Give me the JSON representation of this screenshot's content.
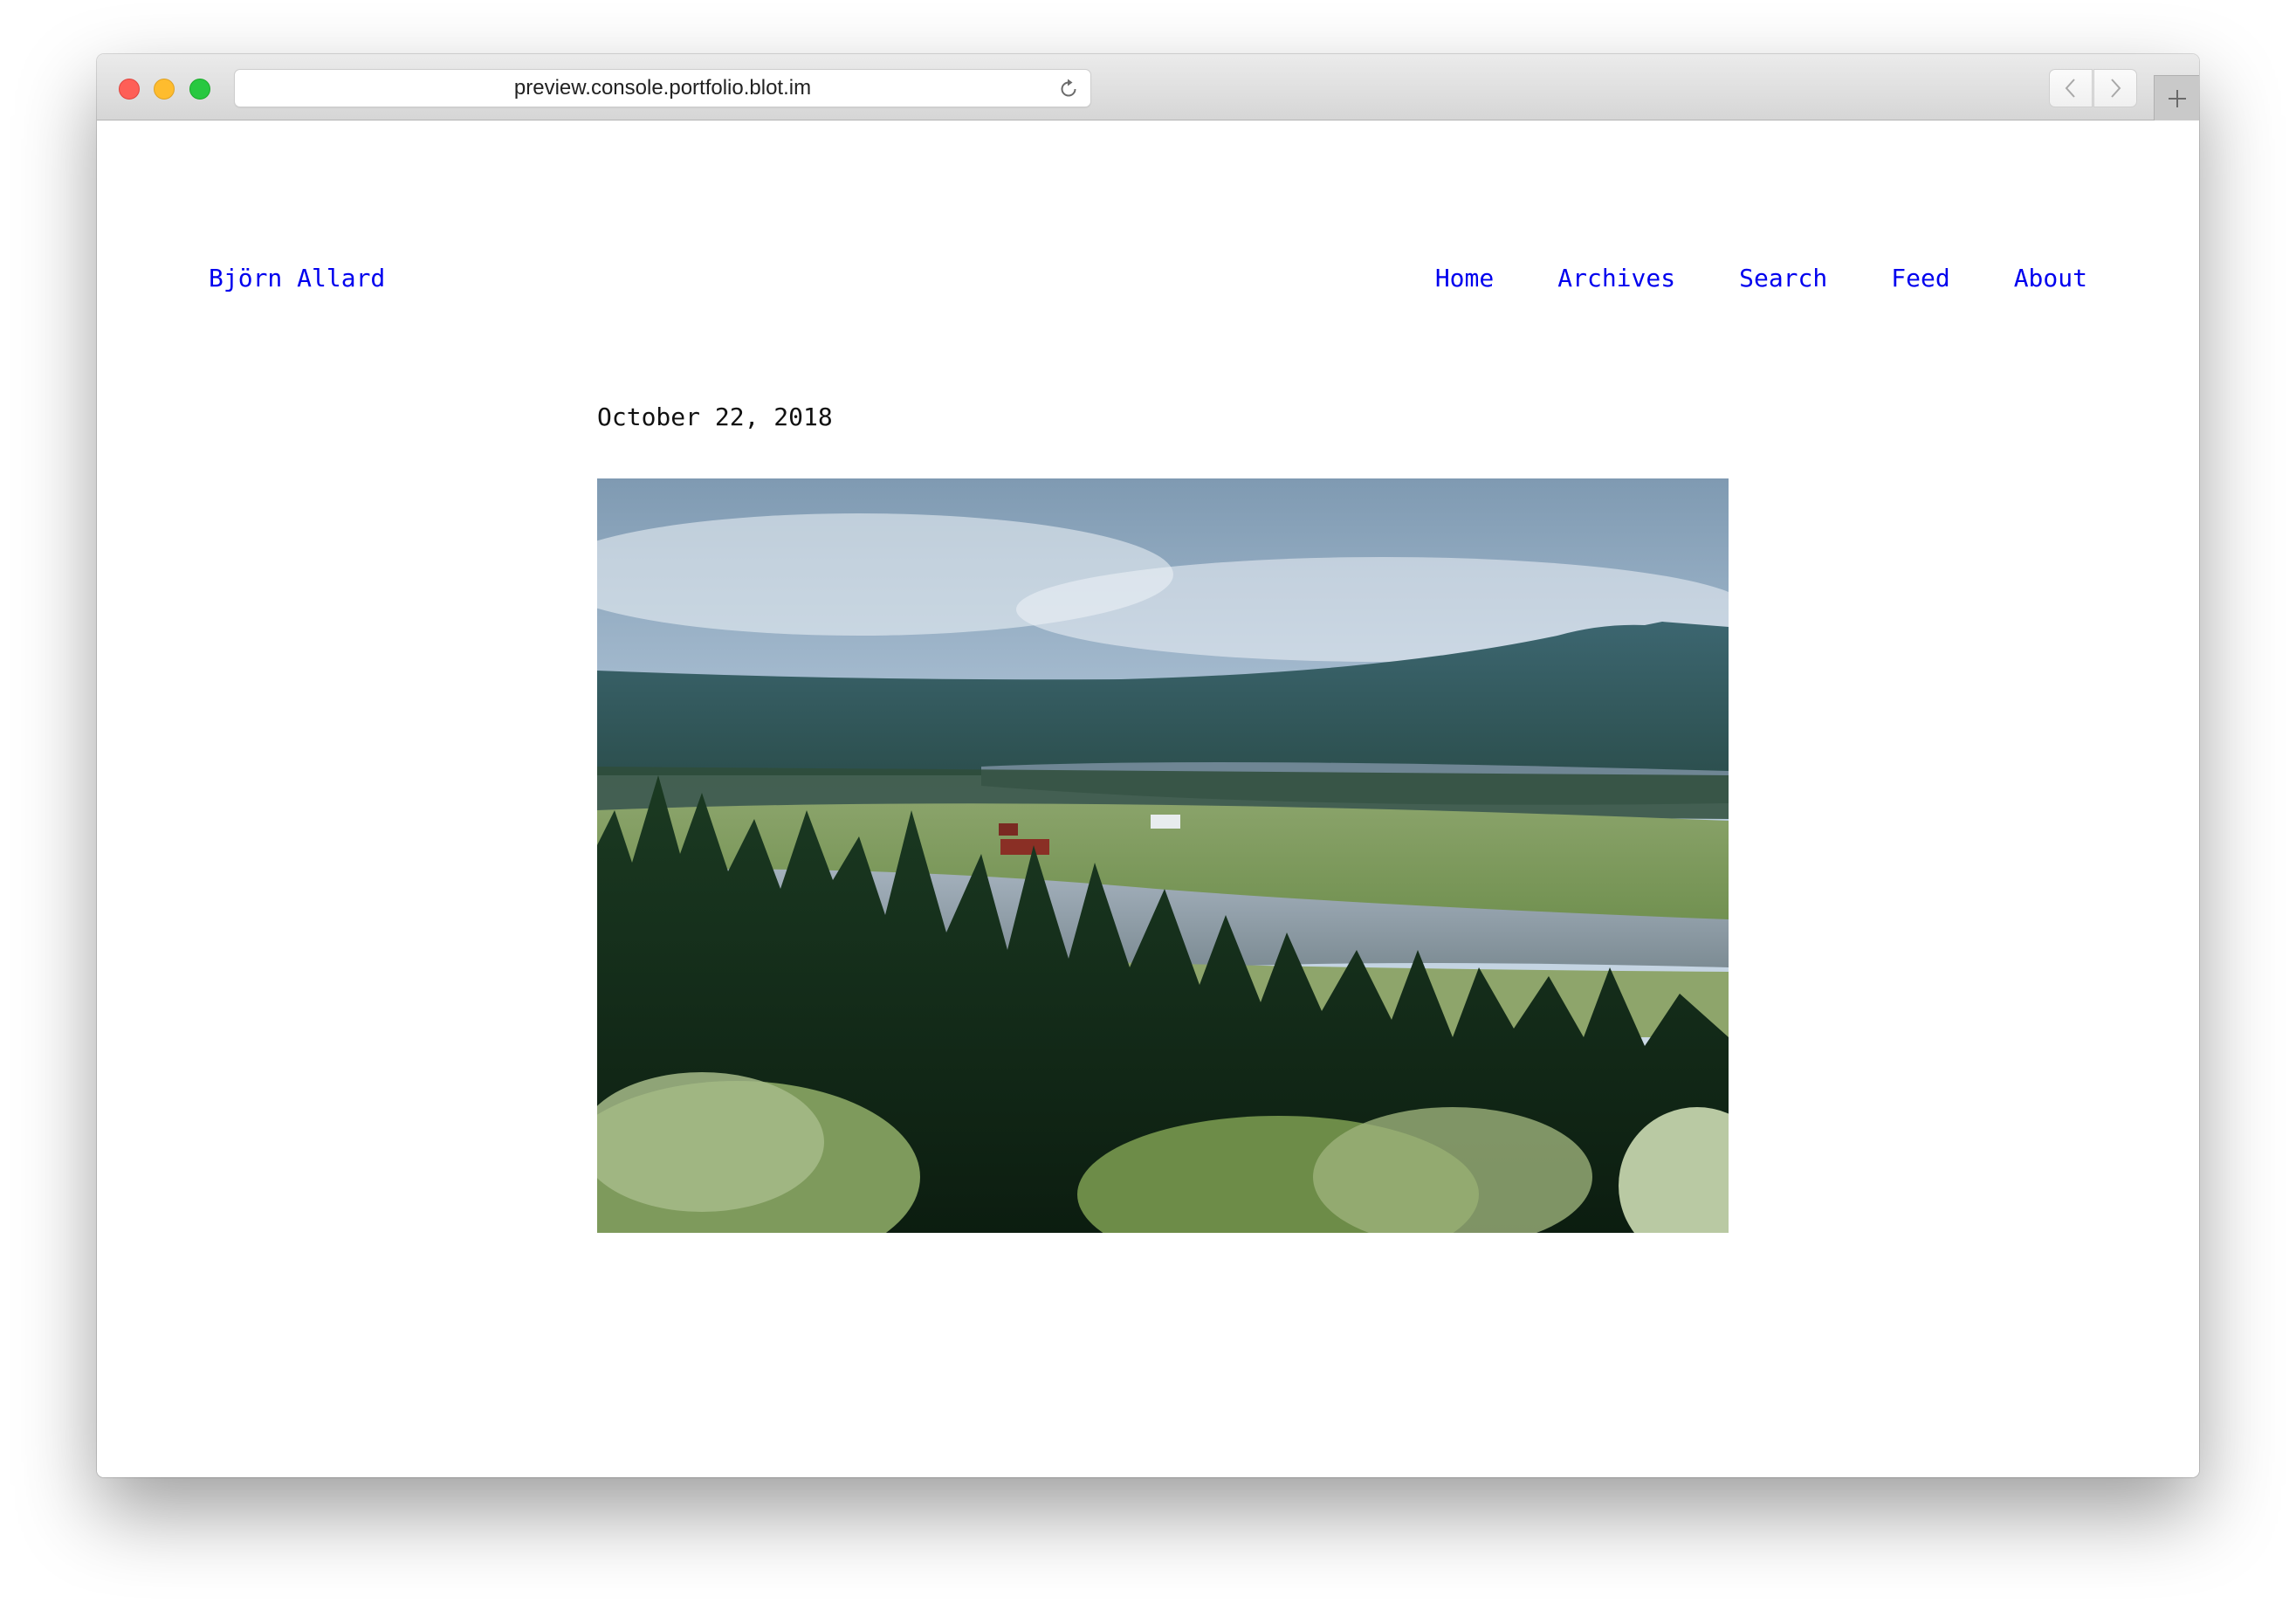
{
  "browser": {
    "url": "preview.console.portfolio.blot.im",
    "back_icon": "chevron-left-icon",
    "forward_icon": "chevron-right-icon",
    "reload_icon": "reload-icon",
    "new_tab_icon": "plus-icon"
  },
  "site": {
    "title": "Björn Allard",
    "link_color": "#0000ee"
  },
  "nav": {
    "items": [
      {
        "label": "Home"
      },
      {
        "label": "Archives"
      },
      {
        "label": "Search"
      },
      {
        "label": "Feed"
      },
      {
        "label": "About"
      }
    ]
  },
  "post": {
    "date": "October 22, 2018"
  }
}
